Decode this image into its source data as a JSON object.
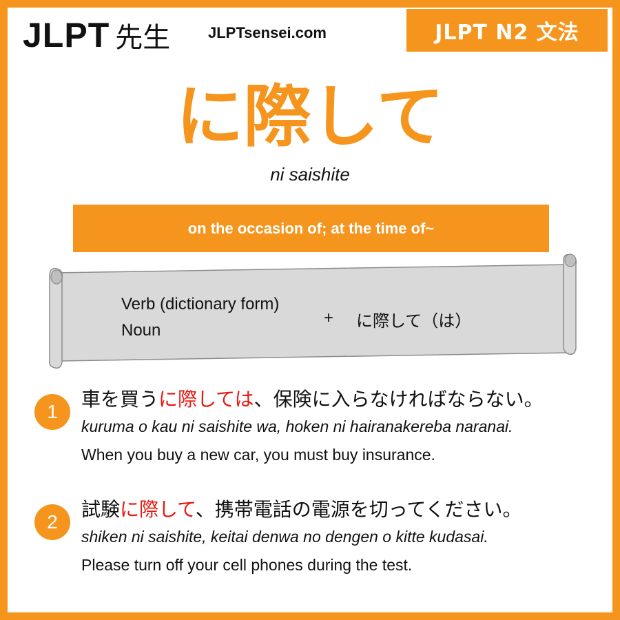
{
  "header": {
    "logo_latin": "JLPT",
    "logo_kanji": "先生",
    "site_url": "JLPTsensei.com",
    "level_badge": "JLPT N2 文法"
  },
  "grammar": {
    "title": "に際して",
    "romaji": "ni saishite",
    "meaning": "on the occasion of; at the time of~"
  },
  "formation": {
    "line1": "Verb (dictionary form)",
    "line2": "Noun",
    "plus": "+",
    "pattern": "に際して（は）"
  },
  "examples": [
    {
      "number": "1",
      "jp_before": "車を買う",
      "jp_highlight": "に際しては",
      "jp_after": "、保険に入らなければならない。",
      "romaji": "kuruma o kau ni saishite wa, hoken ni hairanakereba naranai.",
      "english": "When you buy a new car, you must buy insurance."
    },
    {
      "number": "2",
      "jp_before": "試験",
      "jp_highlight": "に際して",
      "jp_after": "、携帯電話の電源を切ってください。",
      "romaji": "shiken ni saishite, keitai denwa no dengen o kitte kudasai.",
      "english": "Please turn off your cell phones during the test."
    }
  ],
  "colors": {
    "accent": "#f6951d",
    "highlight": "#e8170f",
    "scroll_fill": "#d9d9d9",
    "scroll_stroke": "#8c8c8c"
  }
}
